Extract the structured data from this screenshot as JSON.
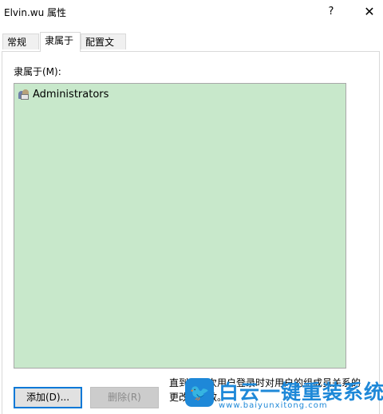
{
  "window": {
    "title": "Elvin.wu 属性",
    "help_label": "?",
    "close_label": "✕"
  },
  "tabs": [
    {
      "label": "常规",
      "active": false
    },
    {
      "label": "隶属于",
      "active": true
    },
    {
      "label": "配置文件",
      "active": false
    }
  ],
  "member_of": {
    "label": "隶属于(M):",
    "items": [
      {
        "icon": "group-icon",
        "label": "Administrators"
      }
    ],
    "list_bg": "#c8e8cb"
  },
  "buttons": {
    "add_label": "添加(D)...",
    "remove_label": "删除(R)"
  },
  "note": "直到下一次用户登录时对用户的组成员关系的更改才生效。",
  "watermark": {
    "title": "白云一键重装系统",
    "url": "www.baiyunxitong.com",
    "color": "#1e88d8"
  }
}
